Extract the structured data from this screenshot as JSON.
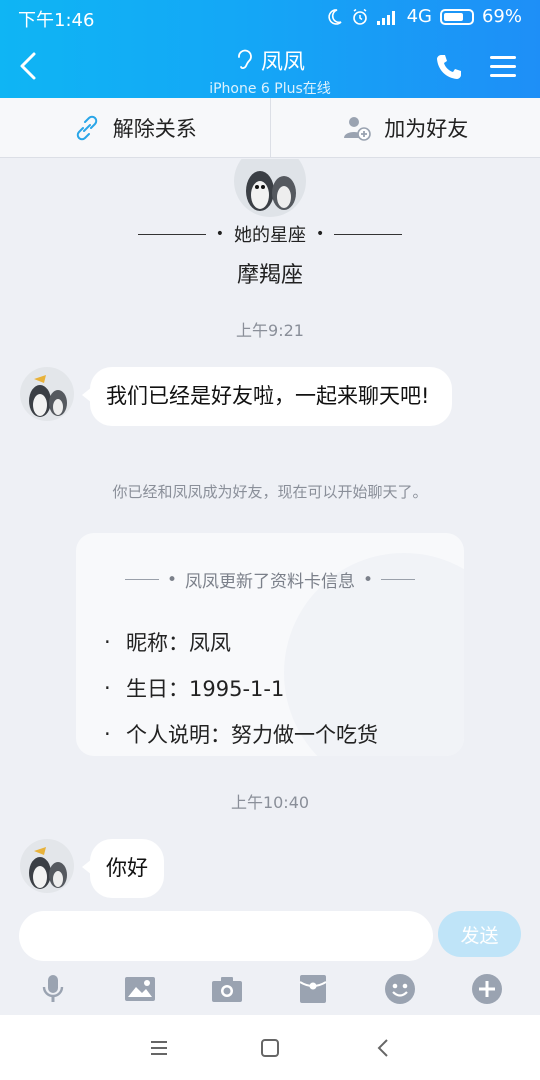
{
  "status_bar": {
    "time": "下午1:46",
    "network": "4G",
    "battery": "69%"
  },
  "header": {
    "title": "凤凤",
    "subtitle": "iPhone 6 Plus在线"
  },
  "relation_bar": {
    "remove": "解除关系",
    "add": "加为好友"
  },
  "profile": {
    "zodiac_label": "她的星座",
    "zodiac_value": "摩羯座"
  },
  "messages": {
    "time1": "上午9:21",
    "msg1": "我们已经是好友啦，一起来聊天吧!",
    "system": "你已经和凤凤成为好友，现在可以开始聊天了。",
    "card_title": "凤凤更新了资料卡信息",
    "card_items": [
      "昵称：凤凤",
      "生日：1995-1-1",
      "个人说明：努力做一个吃货"
    ],
    "time2": "上午10:40",
    "msg2": "你好"
  },
  "input": {
    "placeholder": "",
    "send_label": "发送"
  },
  "colors": {
    "header_start": "#0fb5f4",
    "header_end": "#1e8ff7",
    "send_disabled": "#bfe4f8",
    "icon_gray": "#9aa3b1"
  },
  "icons": {
    "toolbar": [
      "microphone-icon",
      "image-icon",
      "camera-icon",
      "red-packet-icon",
      "emoji-icon",
      "plus-icon"
    ]
  }
}
